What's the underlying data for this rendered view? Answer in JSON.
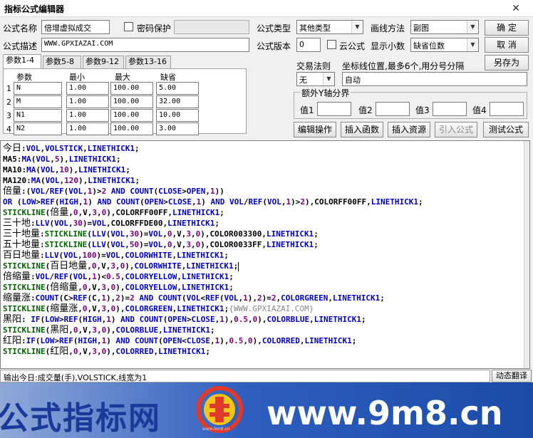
{
  "window": {
    "title": "指标公式编辑器",
    "close_glyph": "✕"
  },
  "form": {
    "name_label": "公式名称",
    "name_value": "倍增虚拟成交",
    "password_label": "密码保护",
    "desc_label": "公式描述",
    "desc_value": "WWW.GPXIAZAI.COM",
    "type_label": "公式类型",
    "type_value": "其他类型",
    "draw_label": "画线方法",
    "draw_value": "副图",
    "version_label": "公式版本",
    "version_value": "0",
    "cloud_label": "云公式",
    "decimals_label": "显示小数",
    "decimals_value": "缺省位数"
  },
  "buttons": {
    "ok": "确  定",
    "cancel": "取  消",
    "save_as": "另存为",
    "edit_ops": "编辑操作",
    "insert_func": "插入函数",
    "insert_res": "插入资源",
    "import_formula": "引入公式",
    "test_formula": "测试公式"
  },
  "tabs": [
    "参数1-4",
    "参数5-8",
    "参数9-12",
    "参数13-16"
  ],
  "param_headers": {
    "name": "参数",
    "min": "最小",
    "max": "最大",
    "default": "缺省"
  },
  "params": [
    {
      "n": "1",
      "name": "N",
      "min": "1.00",
      "max": "100.00",
      "def": "5.00"
    },
    {
      "n": "2",
      "name": "M",
      "min": "1.00",
      "max": "100.00",
      "def": "32.00"
    },
    {
      "n": "3",
      "name": "N1",
      "min": "1.00",
      "max": "100.00",
      "def": "10.00"
    },
    {
      "n": "4",
      "name": "N2",
      "min": "1.00",
      "max": "100.00",
      "def": "3.00"
    }
  ],
  "trade": {
    "rule_label": "交易法则",
    "rule_value": "无",
    "coord_label": "坐标线位置,最多6个,用分号分隔",
    "coord_value": "自动"
  },
  "yaxis": {
    "title": "额外Y轴分界",
    "v1": "值1",
    "v2": "值2",
    "v3": "值3",
    "v4": "值4"
  },
  "code_lines": [
    [
      [
        "cn",
        "今日"
      ],
      [
        "b",
        ":"
      ],
      [
        "u",
        "VOL"
      ],
      [
        "b",
        ","
      ],
      [
        "u",
        "VOLSTICK"
      ],
      [
        "b",
        ","
      ],
      [
        "u",
        "LINETHICK1"
      ],
      [
        "b",
        ";"
      ]
    ],
    [
      [
        "b",
        "MA5:"
      ],
      [
        "u",
        "MA"
      ],
      [
        "b",
        "("
      ],
      [
        "u",
        "VOL"
      ],
      [
        "b",
        ","
      ],
      [
        "p",
        "5"
      ],
      [
        "b",
        "),"
      ],
      [
        "u",
        "LINETHICK1"
      ],
      [
        "b",
        ";"
      ]
    ],
    [
      [
        "b",
        "MA10:"
      ],
      [
        "u",
        "MA"
      ],
      [
        "b",
        "("
      ],
      [
        "u",
        "VOL"
      ],
      [
        "b",
        ","
      ],
      [
        "p",
        "10"
      ],
      [
        "b",
        "),"
      ],
      [
        "u",
        "LINETHICK1"
      ],
      [
        "b",
        ";"
      ]
    ],
    [
      [
        "b",
        "MA120:"
      ],
      [
        "u",
        "MA"
      ],
      [
        "b",
        "("
      ],
      [
        "u",
        "VOL"
      ],
      [
        "b",
        ","
      ],
      [
        "p",
        "120"
      ],
      [
        "b",
        "),"
      ],
      [
        "u",
        "LINETHICK1"
      ],
      [
        "b",
        ";"
      ]
    ],
    [
      [
        "cn",
        "倍量"
      ],
      [
        "b",
        ":("
      ],
      [
        "u",
        "VOL"
      ],
      [
        "b",
        "/"
      ],
      [
        "u",
        "REF"
      ],
      [
        "b",
        "("
      ],
      [
        "u",
        "VOL"
      ],
      [
        "b",
        ","
      ],
      [
        "p",
        "1"
      ],
      [
        "b",
        ")>"
      ],
      [
        "p",
        "2"
      ],
      [
        "b",
        " "
      ],
      [
        "u",
        "AND"
      ],
      [
        "b",
        " "
      ],
      [
        "u",
        "COUNT"
      ],
      [
        "b",
        "("
      ],
      [
        "u",
        "CLOSE"
      ],
      [
        "b",
        ">"
      ],
      [
        "u",
        "OPEN"
      ],
      [
        "b",
        ","
      ],
      [
        "p",
        "1"
      ],
      [
        "b",
        "))"
      ]
    ],
    [
      [
        "u",
        "OR"
      ],
      [
        "b",
        " ("
      ],
      [
        "u",
        "LOW"
      ],
      [
        "b",
        ">"
      ],
      [
        "u",
        "REF"
      ],
      [
        "b",
        "("
      ],
      [
        "u",
        "HIGH"
      ],
      [
        "b",
        ","
      ],
      [
        "p",
        "1"
      ],
      [
        "b",
        ") "
      ],
      [
        "u",
        "AND"
      ],
      [
        "b",
        " "
      ],
      [
        "u",
        "COUNT"
      ],
      [
        "b",
        "("
      ],
      [
        "u",
        "OPEN"
      ],
      [
        "b",
        ">"
      ],
      [
        "u",
        "CLOSE"
      ],
      [
        "b",
        ","
      ],
      [
        "p",
        "1"
      ],
      [
        "b",
        ") "
      ],
      [
        "u",
        "AND"
      ],
      [
        "b",
        " "
      ],
      [
        "u",
        "VOL"
      ],
      [
        "b",
        "/"
      ],
      [
        "u",
        "REF"
      ],
      [
        "b",
        "("
      ],
      [
        "u",
        "VOL"
      ],
      [
        "b",
        ","
      ],
      [
        "p",
        "1"
      ],
      [
        "b",
        ")>"
      ],
      [
        "p",
        "2"
      ],
      [
        "b",
        "),COLORFF00FF,"
      ],
      [
        "u",
        "LINETHICK1"
      ],
      [
        "b",
        ";"
      ]
    ],
    [
      [
        "g",
        "STICKLINE"
      ],
      [
        "b",
        "("
      ],
      [
        "cn",
        "倍量"
      ],
      [
        "b",
        ","
      ],
      [
        "p",
        "0"
      ],
      [
        "b",
        ",V,"
      ],
      [
        "p",
        "3"
      ],
      [
        "b",
        ","
      ],
      [
        "p",
        "0"
      ],
      [
        "b",
        "),COLORFF00FF,"
      ],
      [
        "u",
        "LINETHICK1"
      ],
      [
        "b",
        ";"
      ]
    ],
    [
      [
        "cn",
        "三十地"
      ],
      [
        "b",
        ":"
      ],
      [
        "u",
        "LLV"
      ],
      [
        "b",
        "("
      ],
      [
        "u",
        "VOL"
      ],
      [
        "b",
        ","
      ],
      [
        "p",
        "30"
      ],
      [
        "b",
        ")="
      ],
      [
        "u",
        "VOL"
      ],
      [
        "b",
        ",COLORFFDE00,"
      ],
      [
        "u",
        "LINETHICK1"
      ],
      [
        "b",
        ";"
      ]
    ],
    [
      [
        "cn",
        "三十地量"
      ],
      [
        "b",
        ":"
      ],
      [
        "g",
        "STICKLINE"
      ],
      [
        "b",
        "("
      ],
      [
        "u",
        "LLV"
      ],
      [
        "b",
        "("
      ],
      [
        "u",
        "VOL"
      ],
      [
        "b",
        ","
      ],
      [
        "p",
        "30"
      ],
      [
        "b",
        ")="
      ],
      [
        "u",
        "VOL"
      ],
      [
        "b",
        ","
      ],
      [
        "p",
        "0"
      ],
      [
        "b",
        ",V,"
      ],
      [
        "p",
        "3"
      ],
      [
        "b",
        ","
      ],
      [
        "p",
        "0"
      ],
      [
        "b",
        "),COLOR003300,"
      ],
      [
        "u",
        "LINETHICK1"
      ],
      [
        "b",
        ";"
      ]
    ],
    [
      [
        "cn",
        "五十地量"
      ],
      [
        "b",
        ":"
      ],
      [
        "g",
        "STICKLINE"
      ],
      [
        "b",
        "("
      ],
      [
        "u",
        "LLV"
      ],
      [
        "b",
        "("
      ],
      [
        "u",
        "VOL"
      ],
      [
        "b",
        ","
      ],
      [
        "p",
        "50"
      ],
      [
        "b",
        ")="
      ],
      [
        "u",
        "VOL"
      ],
      [
        "b",
        ","
      ],
      [
        "p",
        "0"
      ],
      [
        "b",
        ",V,"
      ],
      [
        "p",
        "3"
      ],
      [
        "b",
        ","
      ],
      [
        "p",
        "0"
      ],
      [
        "b",
        "),COLOR0033FF,"
      ],
      [
        "u",
        "LINETHICK1"
      ],
      [
        "b",
        ";"
      ]
    ],
    [
      [
        "cn",
        "百日地量"
      ],
      [
        "b",
        ":"
      ],
      [
        "u",
        "LLV"
      ],
      [
        "b",
        "("
      ],
      [
        "u",
        "VOL"
      ],
      [
        "b",
        ","
      ],
      [
        "p",
        "100"
      ],
      [
        "b",
        ")="
      ],
      [
        "u",
        "VOL"
      ],
      [
        "b",
        ","
      ],
      [
        "u",
        "COLORWHITE"
      ],
      [
        "b",
        ","
      ],
      [
        "u",
        "LINETHICK1"
      ],
      [
        "b",
        ";"
      ]
    ],
    [
      [
        "g",
        "STICKLINE"
      ],
      [
        "b",
        "("
      ],
      [
        "cn",
        "百日地量"
      ],
      [
        "b",
        ","
      ],
      [
        "p",
        "0"
      ],
      [
        "b",
        ",V,"
      ],
      [
        "p",
        "3"
      ],
      [
        "b",
        ","
      ],
      [
        "p",
        "0"
      ],
      [
        "b",
        "),"
      ],
      [
        "u",
        "COLORWHITE"
      ],
      [
        "b",
        ","
      ],
      [
        "u",
        "LINETHICK1"
      ],
      [
        "b",
        ";"
      ],
      [
        "caret",
        ""
      ]
    ],
    [
      [
        "cn",
        "倍缩量"
      ],
      [
        "b",
        ":"
      ],
      [
        "u",
        "VOL"
      ],
      [
        "b",
        "/"
      ],
      [
        "u",
        "REF"
      ],
      [
        "b",
        "("
      ],
      [
        "u",
        "VOL"
      ],
      [
        "b",
        ","
      ],
      [
        "p",
        "1"
      ],
      [
        "b",
        ")<"
      ],
      [
        "p",
        "0.5"
      ],
      [
        "b",
        ","
      ],
      [
        "u",
        "COLORYELLOW"
      ],
      [
        "b",
        ","
      ],
      [
        "u",
        "LINETHICK1"
      ],
      [
        "b",
        ";"
      ]
    ],
    [
      [
        "g",
        "STICKLINE"
      ],
      [
        "b",
        "("
      ],
      [
        "cn",
        "倍缩量"
      ],
      [
        "b",
        ","
      ],
      [
        "p",
        "0"
      ],
      [
        "b",
        ",V,"
      ],
      [
        "p",
        "3"
      ],
      [
        "b",
        ","
      ],
      [
        "p",
        "0"
      ],
      [
        "b",
        "),"
      ],
      [
        "u",
        "COLORYELLOW"
      ],
      [
        "b",
        ","
      ],
      [
        "u",
        "LINETHICK1"
      ],
      [
        "b",
        ";"
      ]
    ],
    [
      [
        "cn",
        "缩量涨"
      ],
      [
        "b",
        ":"
      ],
      [
        "u",
        "COUNT"
      ],
      [
        "b",
        "(C>"
      ],
      [
        "u",
        "REF"
      ],
      [
        "b",
        "(C,"
      ],
      [
        "p",
        "1"
      ],
      [
        "b",
        "),"
      ],
      [
        "p",
        "2"
      ],
      [
        "b",
        ")="
      ],
      [
        "p",
        "2"
      ],
      [
        "b",
        " "
      ],
      [
        "u",
        "AND"
      ],
      [
        "b",
        " "
      ],
      [
        "u",
        "COUNT"
      ],
      [
        "b",
        "("
      ],
      [
        "u",
        "VOL"
      ],
      [
        "b",
        "<"
      ],
      [
        "u",
        "REF"
      ],
      [
        "b",
        "("
      ],
      [
        "u",
        "VOL"
      ],
      [
        "b",
        ","
      ],
      [
        "p",
        "1"
      ],
      [
        "b",
        "),"
      ],
      [
        "p",
        "2"
      ],
      [
        "b",
        ")="
      ],
      [
        "p",
        "2"
      ],
      [
        "b",
        ","
      ],
      [
        "u",
        "COLORGREEN"
      ],
      [
        "b",
        ","
      ],
      [
        "u",
        "LINETHICK1"
      ],
      [
        "b",
        ";"
      ]
    ],
    [
      [
        "g",
        "STICKLINE"
      ],
      [
        "b",
        "("
      ],
      [
        "cn",
        "缩量涨"
      ],
      [
        "b",
        ","
      ],
      [
        "p",
        "0"
      ],
      [
        "b",
        ",V,"
      ],
      [
        "p",
        "3"
      ],
      [
        "b",
        ","
      ],
      [
        "p",
        "0"
      ],
      [
        "b",
        "),"
      ],
      [
        "u",
        "COLORGREEN"
      ],
      [
        "b",
        ","
      ],
      [
        "u",
        "LINETHICK1"
      ],
      [
        "b",
        ";"
      ],
      [
        "x",
        "{WWW.GPXIAZAI.COM}"
      ]
    ],
    [
      [
        "cn",
        "黑阳"
      ],
      [
        "b",
        ": "
      ],
      [
        "u",
        "IF"
      ],
      [
        "b",
        "("
      ],
      [
        "u",
        "LOW"
      ],
      [
        "b",
        ">"
      ],
      [
        "u",
        "REF"
      ],
      [
        "b",
        "("
      ],
      [
        "u",
        "HIGH"
      ],
      [
        "b",
        ","
      ],
      [
        "p",
        "1"
      ],
      [
        "b",
        ") "
      ],
      [
        "u",
        "AND"
      ],
      [
        "b",
        " "
      ],
      [
        "u",
        "COUNT"
      ],
      [
        "b",
        "("
      ],
      [
        "u",
        "OPEN"
      ],
      [
        "b",
        ">"
      ],
      [
        "u",
        "CLOSE"
      ],
      [
        "b",
        ","
      ],
      [
        "p",
        "1"
      ],
      [
        "b",
        "),"
      ],
      [
        "p",
        "0.5"
      ],
      [
        "b",
        ","
      ],
      [
        "p",
        "0"
      ],
      [
        "b",
        "),"
      ],
      [
        "u",
        "COLORBLUE"
      ],
      [
        "b",
        ","
      ],
      [
        "u",
        "LINETHICK1"
      ],
      [
        "b",
        ";"
      ]
    ],
    [
      [
        "g",
        "STICKLINE"
      ],
      [
        "b",
        "("
      ],
      [
        "cn",
        "黑阳"
      ],
      [
        "b",
        ","
      ],
      [
        "p",
        "0"
      ],
      [
        "b",
        ",V,"
      ],
      [
        "p",
        "3"
      ],
      [
        "b",
        ","
      ],
      [
        "p",
        "0"
      ],
      [
        "b",
        "),"
      ],
      [
        "u",
        "COLORBLUE"
      ],
      [
        "b",
        ","
      ],
      [
        "u",
        "LINETHICK1"
      ],
      [
        "b",
        ";"
      ]
    ],
    [
      [
        "cn",
        "红阳"
      ],
      [
        "b",
        ":"
      ],
      [
        "u",
        "IF"
      ],
      [
        "b",
        "("
      ],
      [
        "u",
        "LOW"
      ],
      [
        "b",
        ">"
      ],
      [
        "u",
        "REF"
      ],
      [
        "b",
        "("
      ],
      [
        "u",
        "HIGH"
      ],
      [
        "b",
        ","
      ],
      [
        "p",
        "1"
      ],
      [
        "b",
        ") "
      ],
      [
        "u",
        "AND"
      ],
      [
        "b",
        " "
      ],
      [
        "u",
        "COUNT"
      ],
      [
        "b",
        "("
      ],
      [
        "u",
        "OPEN"
      ],
      [
        "b",
        "<"
      ],
      [
        "u",
        "CLOSE"
      ],
      [
        "b",
        ","
      ],
      [
        "p",
        "1"
      ],
      [
        "b",
        "),"
      ],
      [
        "p",
        "0.5"
      ],
      [
        "b",
        ","
      ],
      [
        "p",
        "0"
      ],
      [
        "b",
        "),"
      ],
      [
        "u",
        "COLORRED"
      ],
      [
        "b",
        ","
      ],
      [
        "u",
        "LINETHICK1"
      ],
      [
        "b",
        ";"
      ]
    ],
    [
      [
        "g",
        "STICKLINE"
      ],
      [
        "b",
        "("
      ],
      [
        "cn",
        "红阳"
      ],
      [
        "b",
        ","
      ],
      [
        "p",
        "0"
      ],
      [
        "b",
        ",V,"
      ],
      [
        "p",
        "3"
      ],
      [
        "b",
        ","
      ],
      [
        "p",
        "0"
      ],
      [
        "b",
        "),"
      ],
      [
        "u",
        "COLORRED"
      ],
      [
        "b",
        ","
      ],
      [
        "u",
        "LINETHICK1"
      ],
      [
        "b",
        ";"
      ]
    ]
  ],
  "status": {
    "text": "输出今日:成交量(手),VOLSTICK,线宽为1",
    "dynamic_translate": "动态翻译"
  },
  "banner": {
    "left_text": "公式指标网",
    "right_text": "www.9m8.cn",
    "logo_url": "www.9m8.cn"
  },
  "colors": {
    "title_bg": "#ffffff",
    "dialog_bg": "#f0f0f0",
    "keyword": "#0000c8",
    "stickline": "#006400",
    "number": "#800080",
    "banner_blue": "#1a4ba8"
  }
}
